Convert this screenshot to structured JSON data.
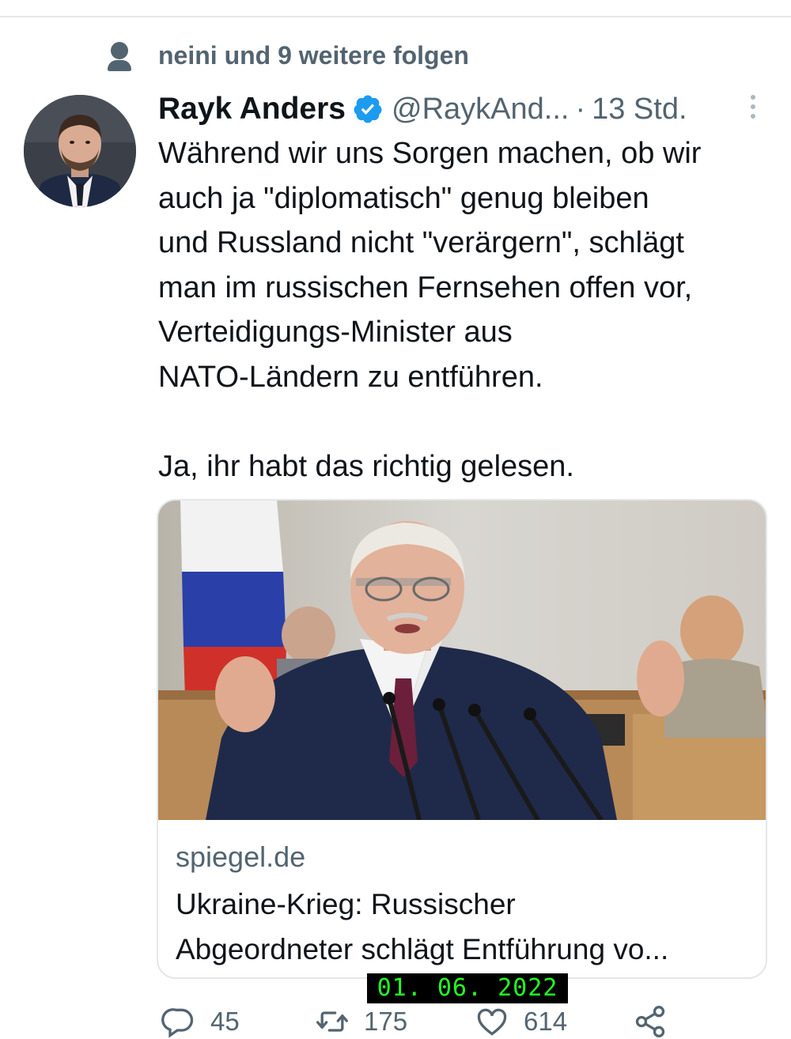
{
  "social_context": {
    "text": "neini und 9 weitere folgen",
    "icon": "person-icon"
  },
  "tweet": {
    "author_name": "Rayk Anders",
    "verified_icon": "verified-badge-icon",
    "handle": "@RaykAnd...",
    "separator": "·",
    "time": "13 Std.",
    "text_lines": [
      "Während wir uns Sorgen machen, ob wir",
      "auch ja \"diplomatisch\" genug bleiben",
      "und Russland nicht \"verärgern\", schlägt",
      "man im russischen Fernsehen offen vor,",
      "Verteidigungs-Minister aus",
      "NATO-Ländern zu entführen."
    ],
    "text_final": "Ja, ihr habt das richtig gelesen."
  },
  "link_card": {
    "domain": "spiegel.de",
    "title_line1": "Ukraine-Krieg: Russischer",
    "title_line2": "Abgeordneter schlägt Entführung vo..."
  },
  "overlay": {
    "date_stamp": "01. 06. 2022"
  },
  "actions": {
    "reply_count": "45",
    "retweet_count": "175",
    "like_count": "614"
  },
  "colors": {
    "text_primary": "#0f1419",
    "text_secondary": "#536471",
    "verified_blue": "#1d9bf0",
    "border": "#e3e7ea",
    "stamp_text": "#22ff22"
  }
}
